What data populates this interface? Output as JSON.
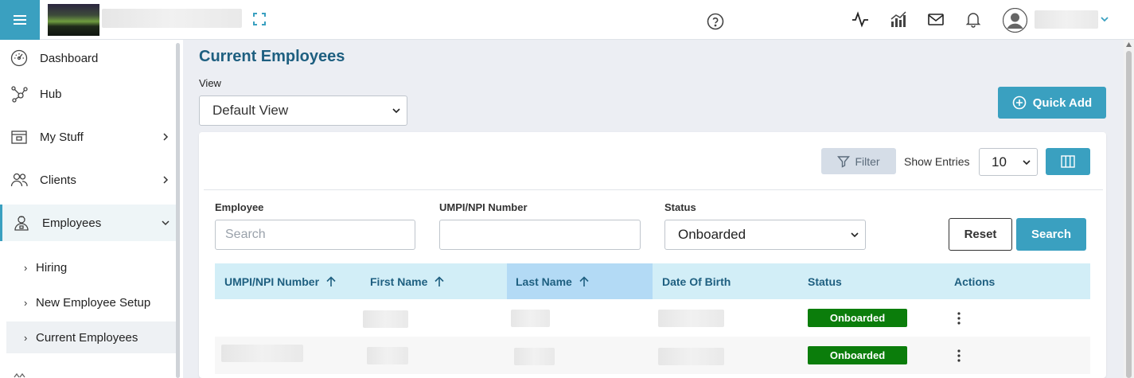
{
  "sidebar": {
    "items": [
      {
        "label": "Dashboard",
        "icon": "dashboard-icon"
      },
      {
        "label": "Hub",
        "icon": "hub-icon"
      },
      {
        "label": "My Stuff",
        "icon": "my-stuff-icon"
      },
      {
        "label": "Clients",
        "icon": "clients-icon"
      },
      {
        "label": "Employees",
        "icon": "employees-icon"
      }
    ],
    "sub_items": [
      {
        "label": "Hiring"
      },
      {
        "label": "New Employee Setup"
      },
      {
        "label": "Current Employees"
      }
    ]
  },
  "main": {
    "title": "Current Employees",
    "view_label": "View",
    "view_value": "Default View",
    "quick_add_label": "Quick Add",
    "filter_label": "Filter",
    "show_entries_label": "Show Entries",
    "entries_value": "10",
    "filters": {
      "employee_label": "Employee",
      "employee_placeholder": "Search",
      "npi_label": "UMPI/NPI Number",
      "npi_value": "",
      "status_label": "Status",
      "status_value": "Onboarded"
    },
    "reset_label": "Reset",
    "search_label": "Search"
  },
  "table": {
    "columns": [
      "UMPI/NPI Number",
      "First Name",
      "Last Name",
      "Date Of Birth",
      "Status",
      "Actions"
    ],
    "sorted_column": "Last Name",
    "rows": [
      {
        "status": "Onboarded"
      },
      {
        "status": "Onboarded"
      }
    ]
  },
  "colors": {
    "accent": "#3aa0c0",
    "title": "#1e5f80",
    "status_onboarded": "#0b7d0b",
    "table_header": "#d2eef7"
  }
}
